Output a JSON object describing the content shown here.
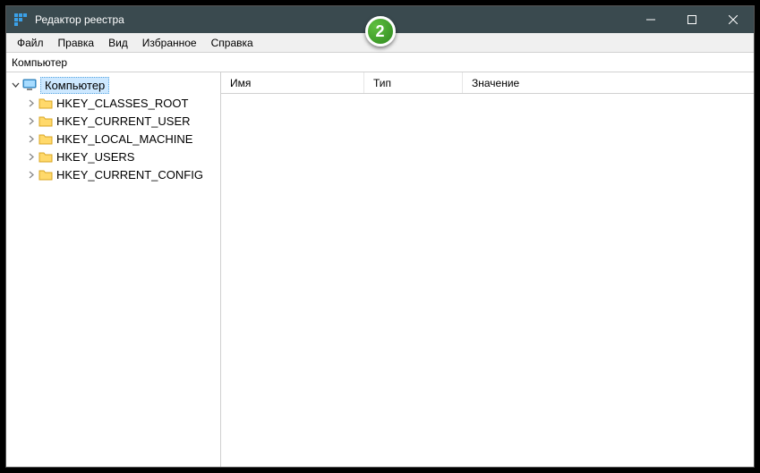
{
  "badge": "2",
  "titlebar": {
    "title": "Редактор реестра"
  },
  "menu": {
    "file": "Файл",
    "edit": "Правка",
    "view": "Вид",
    "favorites": "Избранное",
    "help": "Справка"
  },
  "address": {
    "path": "Компьютер"
  },
  "tree": {
    "root": "Компьютер",
    "keys": [
      "HKEY_CLASSES_ROOT",
      "HKEY_CURRENT_USER",
      "HKEY_LOCAL_MACHINE",
      "HKEY_USERS",
      "HKEY_CURRENT_CONFIG"
    ]
  },
  "columns": {
    "name": "Имя",
    "type": "Тип",
    "value": "Значение"
  }
}
